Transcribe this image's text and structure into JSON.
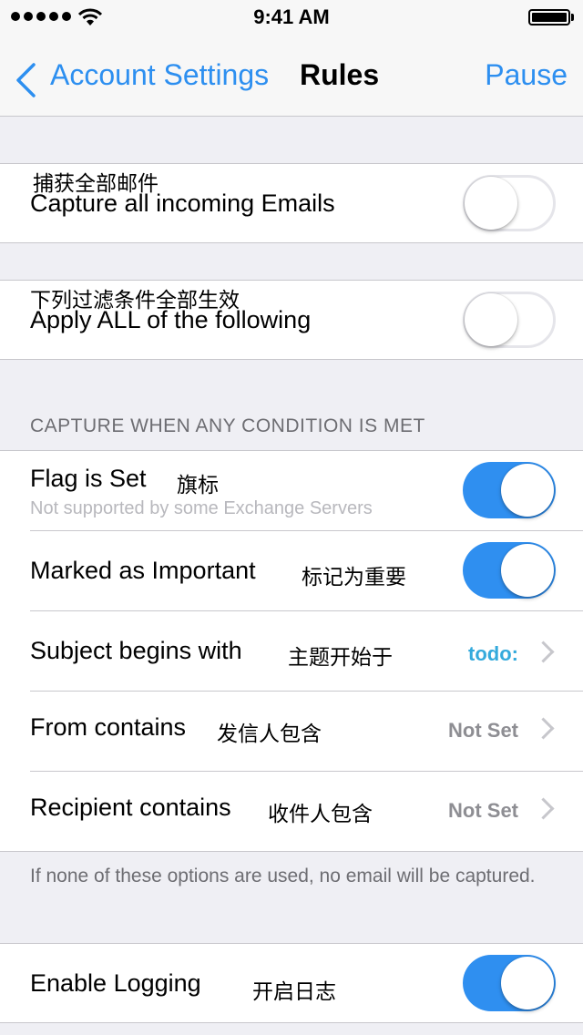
{
  "status_bar": {
    "time": "9:41 AM"
  },
  "nav": {
    "back_label": "Account Settings",
    "title": "Rules",
    "action": "Pause"
  },
  "capture_all": {
    "label_cn": "捕获全部邮件",
    "label": "Capture all incoming Emails",
    "enabled": false
  },
  "apply_all": {
    "label_cn": "下列过滤条件全部生效",
    "label": "Apply ALL of the following",
    "enabled": false
  },
  "conditions": {
    "header": "CAPTURE WHEN ANY CONDITION IS MET",
    "flag": {
      "label": "Flag is Set",
      "label_cn": "旗标",
      "subtitle": "Not supported by some Exchange Servers",
      "enabled": true
    },
    "important": {
      "label": "Marked as Important",
      "label_cn": "标记为重要",
      "enabled": true
    },
    "subject": {
      "label": "Subject begins with",
      "label_cn": "主题开始于",
      "value": "todo:"
    },
    "from": {
      "label": "From contains",
      "label_cn": "发信人包含",
      "value": "Not Set"
    },
    "recipient": {
      "label": "Recipient contains",
      "label_cn": "收件人包含",
      "value": "Not Set"
    },
    "footer": "If none of these options are used, no email will be captured."
  },
  "logging": {
    "label": "Enable Logging",
    "label_cn": "开启日志",
    "enabled": true
  },
  "colors": {
    "accent": "#2d8ff0",
    "switch_on": "#2f8ff0",
    "value_blue": "#34aadc",
    "background": "#efeff4"
  }
}
